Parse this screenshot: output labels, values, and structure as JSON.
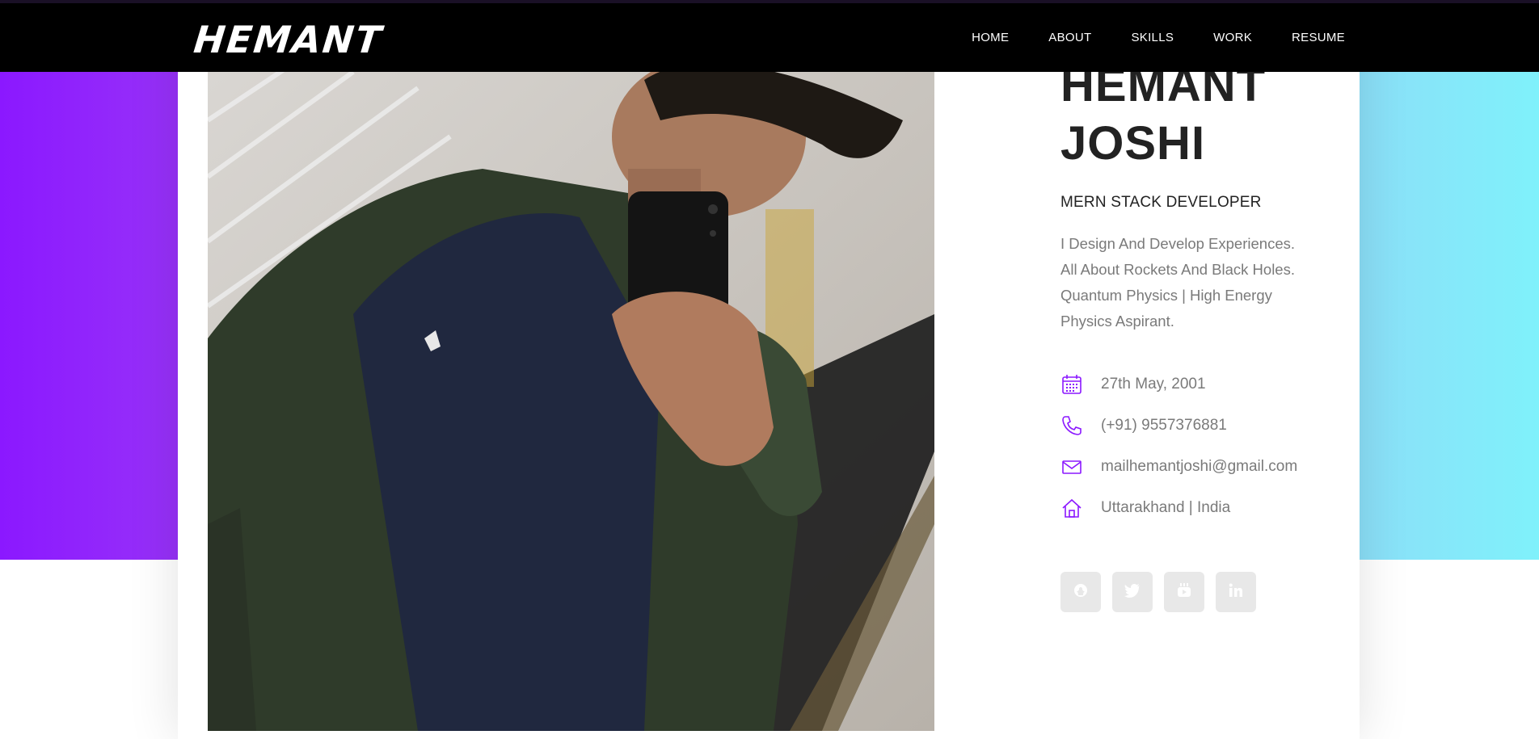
{
  "header": {
    "logo": "HEMANT",
    "nav": [
      "HOME",
      "ABOUT",
      "SKILLS",
      "WORK",
      "RESUME"
    ]
  },
  "profile": {
    "name_line1": "HEMANT",
    "name_line2": "JOSHI",
    "role": "MERN STACK DEVELOPER",
    "bio_lines": [
      "I Design And Develop Experiences.",
      "All About Rockets And Black Holes.",
      "Quantum Physics | High Energy",
      "Physics Aspirant."
    ],
    "details": [
      {
        "icon": "calendar-icon",
        "text": "27th May, 2001"
      },
      {
        "icon": "phone-icon",
        "text": "(+91) 9557376881"
      },
      {
        "icon": "mail-icon",
        "text": "mailhemantjoshi@gmail.com"
      },
      {
        "icon": "home-icon",
        "text": "Uttarakhand | India"
      }
    ],
    "socials": [
      "github-icon",
      "twitter-icon",
      "youtube-icon",
      "linkedin-icon"
    ]
  },
  "colors": {
    "accent": "#8b18ff",
    "gradient_left": "#8b18ff",
    "gradient_right": "#7ff1fb"
  }
}
